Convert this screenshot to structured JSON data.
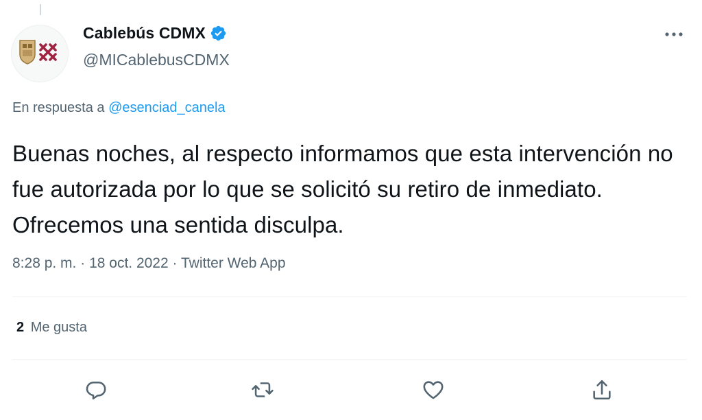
{
  "tweet": {
    "author": {
      "display_name": "Cablebús CDMX",
      "handle": "@MICablebusCDMX",
      "verified": true
    },
    "reply_to": {
      "prefix": "En respuesta a",
      "mention": "@esenciad_canela"
    },
    "text": "Buenas noches, al respecto informamos que esta intervención no fue autorizada por lo que se solicitó su retiro de inmediato. Ofrecemos una sentida disculpa.",
    "time": "8:28 p. m.",
    "separator": "·",
    "date": "18 oct. 2022",
    "source": "Twitter Web App",
    "likes": {
      "count": "2",
      "label": "Me gusta"
    }
  },
  "icons": {
    "more": "more-icon",
    "verified": "verified-badge-icon",
    "reply": "reply-icon",
    "retweet": "retweet-icon",
    "like": "heart-icon",
    "share": "share-icon"
  },
  "colors": {
    "accent": "#1d9bf0",
    "secondary_text": "#536471",
    "primary_text": "#0f1419",
    "brand_maroon": "#9f2241"
  }
}
